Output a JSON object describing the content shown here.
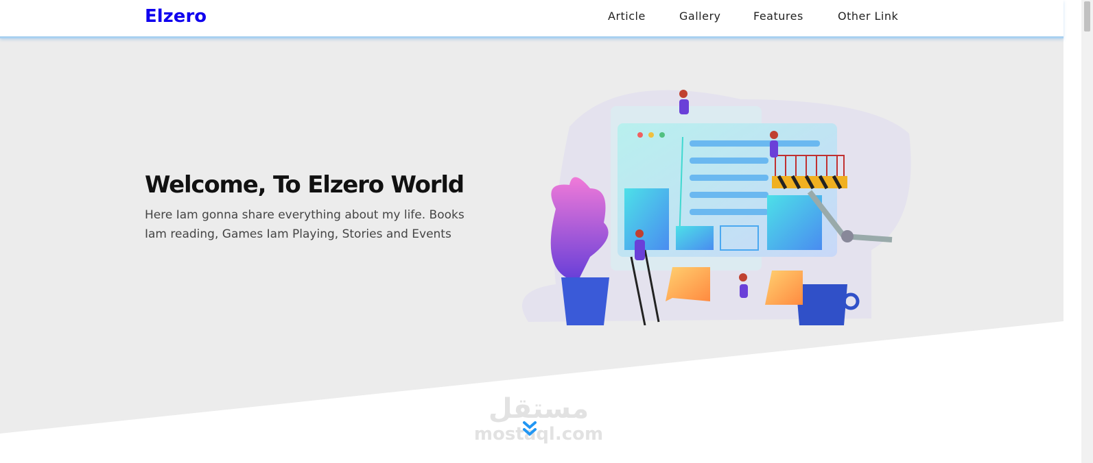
{
  "header": {
    "logo": "Elzero",
    "nav": [
      "Article",
      "Gallery",
      "Features",
      "Other Link"
    ]
  },
  "hero": {
    "title": "Welcome, To Elzero World",
    "description": "Here Iam gonna share everything about my life. Books Iam reading, Games Iam Playing, Stories and Events"
  },
  "watermark": {
    "arabic": "مستقل",
    "latin": "mostaql.com"
  },
  "colors": {
    "brand": "#1000ee",
    "accent": "#2196f3",
    "hero_bg": "#ececec"
  },
  "icons": {
    "scroll_down": "double-chevron-down-icon"
  }
}
